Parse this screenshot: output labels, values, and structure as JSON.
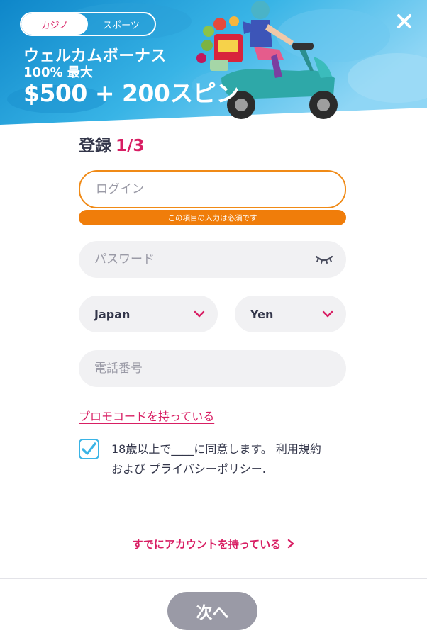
{
  "banner": {
    "tabs": [
      {
        "label": "カジノ",
        "active": true
      },
      {
        "label": "スポーツ",
        "active": false
      }
    ],
    "promo_line1": "ウェルカムボーナス",
    "promo_line2": "100% 最大",
    "promo_line3": "$500 + 200スピン",
    "close_icon": "close-icon"
  },
  "form": {
    "title": "登録",
    "step": "1/3",
    "login_placeholder": "ログイン",
    "login_error": "この項目の入力は必須です",
    "password_placeholder": "パスワード",
    "password_icon": "eye-closed-icon",
    "country": "Japan",
    "currency": "Yen",
    "phone_placeholder": "電話番号",
    "promo_link": "プロモコードを持っている",
    "terms_prefix": "18歳以上で____に同意します。",
    "terms_link": "利用規約",
    "terms_and": "および",
    "privacy_link": "プライバシーポリシー",
    "terms_end": ".",
    "checkbox_checked": true,
    "have_account_link": "すでにアカウントを持っている",
    "next_button": "次へ"
  },
  "colors": {
    "accent": "#d81e63",
    "error": "#f07d0a",
    "checkbox": "#3ab4e6",
    "button_disabled": "#9a9aa6",
    "banner_blue": "#1aa3d9"
  }
}
